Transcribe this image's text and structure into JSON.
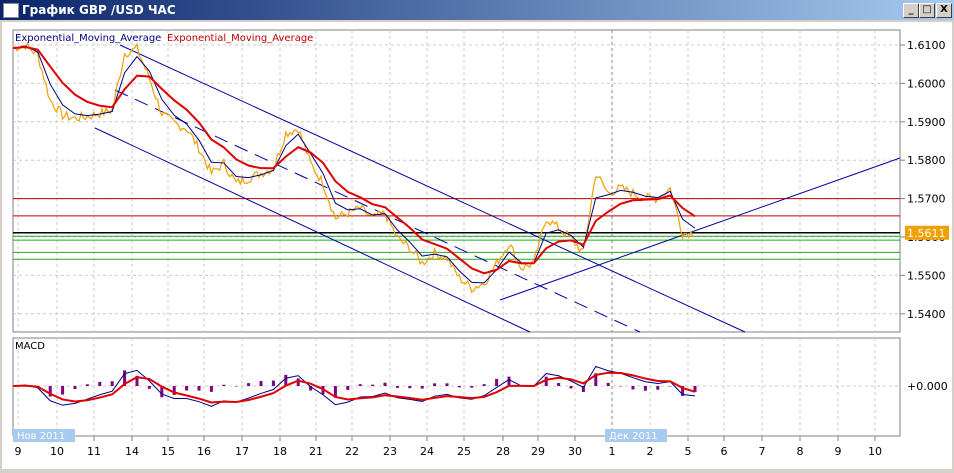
{
  "window": {
    "title": "График GBP /USD  ЧАС",
    "min": "_",
    "max": "□",
    "close": "X"
  },
  "chart_data": {
    "type": "line",
    "title": "GBP/USD H1",
    "legend": [
      "Exponential_Moving_Average",
      "Exponential_Moving_Average"
    ],
    "ylim": [
      1.535,
      1.612
    ],
    "yticks": [
      "1.6100",
      "1.6000",
      "1.5900",
      "1.5800",
      "1.5700",
      "1.5600",
      "1.5500",
      "1.5400"
    ],
    "current_price": "1.5611",
    "xticks": [
      "9",
      "10",
      "11",
      "14",
      "15",
      "16",
      "17",
      "18",
      "21",
      "22",
      "23",
      "24",
      "25",
      "28",
      "29",
      "30",
      "1",
      "2",
      "5",
      "6",
      "7",
      "8",
      "9",
      "10"
    ],
    "month_labels": [
      "Нов 2011",
      "Дек 2011"
    ],
    "price_series": [
      1.6092,
      1.61,
      1.6074,
      1.5956,
      1.5917,
      1.5909,
      1.5914,
      1.5922,
      1.593,
      1.6078,
      1.6091,
      1.6013,
      1.5922,
      1.5896,
      1.5883,
      1.5831,
      1.5766,
      1.5792,
      1.574,
      1.5753,
      1.5766,
      1.5779,
      1.587,
      1.5883,
      1.5792,
      1.574,
      1.5649,
      1.5662,
      1.5675,
      1.5649,
      1.5662,
      1.5597,
      1.5571,
      1.5532,
      1.5558,
      1.5545,
      1.5493,
      1.5467,
      1.548,
      1.5532,
      1.5584,
      1.5519,
      1.5532,
      1.5649,
      1.5623,
      1.5597,
      1.5558,
      1.5766,
      1.5714,
      1.5727,
      1.5714,
      1.5701,
      1.5701,
      1.5727,
      1.561,
      1.5611
    ],
    "ema_fast_period_label": "Exponential_Moving_Average",
    "levels": {
      "red": [
        1.57,
        1.5655
      ],
      "black": [
        1.5611
      ],
      "green": [
        1.5602,
        1.5592,
        1.556,
        1.5542
      ]
    },
    "macd": {
      "label": "MACD",
      "zero_label": "+0.000"
    }
  }
}
